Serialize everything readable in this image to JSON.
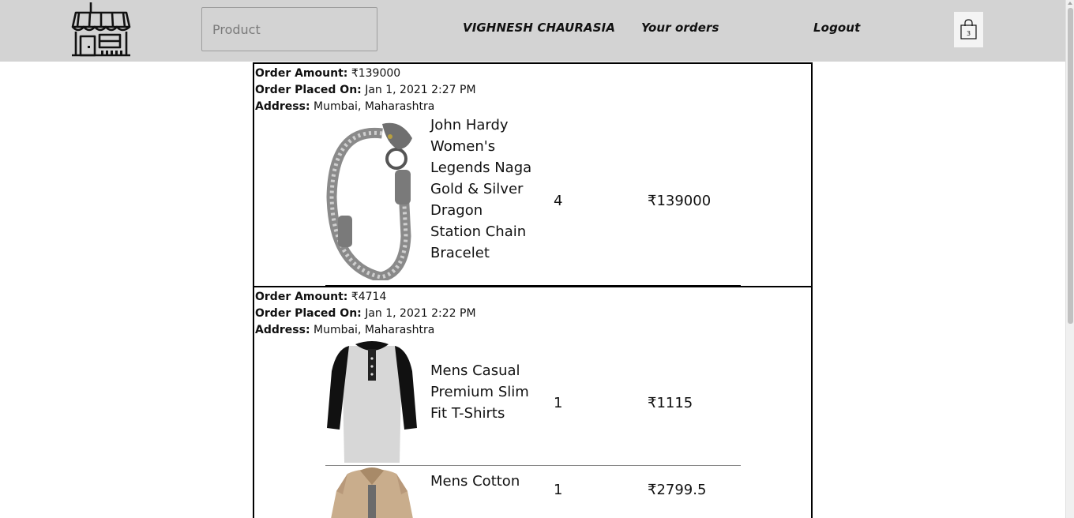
{
  "header": {
    "search_placeholder": "Product",
    "user_name": "VIGHNESH CHAURASIA",
    "orders_link": "Your orders",
    "logout_link": "Logout",
    "cart_count": "3",
    "background": "#d3d3d3"
  },
  "orders": [
    {
      "amount_label": "Order Amount:",
      "amount": "₹139000",
      "placed_label": "Order Placed On:",
      "placed_on": "Jan 1, 2021 2:27 PM",
      "address_label": "Address:",
      "address": "Mumbai, Maharashtra",
      "items": [
        {
          "name": "John Hardy Women's Legends Naga Gold & Silver Dragon Station Chain Bracelet",
          "quantity": "4",
          "price": "₹139000",
          "image_icon": "bracelet-image"
        }
      ]
    },
    {
      "amount_label": "Order Amount:",
      "amount": "₹4714",
      "placed_label": "Order Placed On:",
      "placed_on": "Jan 1, 2021 2:22 PM",
      "address_label": "Address:",
      "address": "Mumbai, Maharashtra",
      "items": [
        {
          "name": "Mens Casual Premium Slim Fit T-Shirts",
          "quantity": "1",
          "price": "₹1115",
          "image_icon": "tshirt-image"
        },
        {
          "name": "Mens Cotton",
          "quantity": "1",
          "price": "₹2799.5",
          "image_icon": "jacket-image"
        }
      ]
    }
  ]
}
